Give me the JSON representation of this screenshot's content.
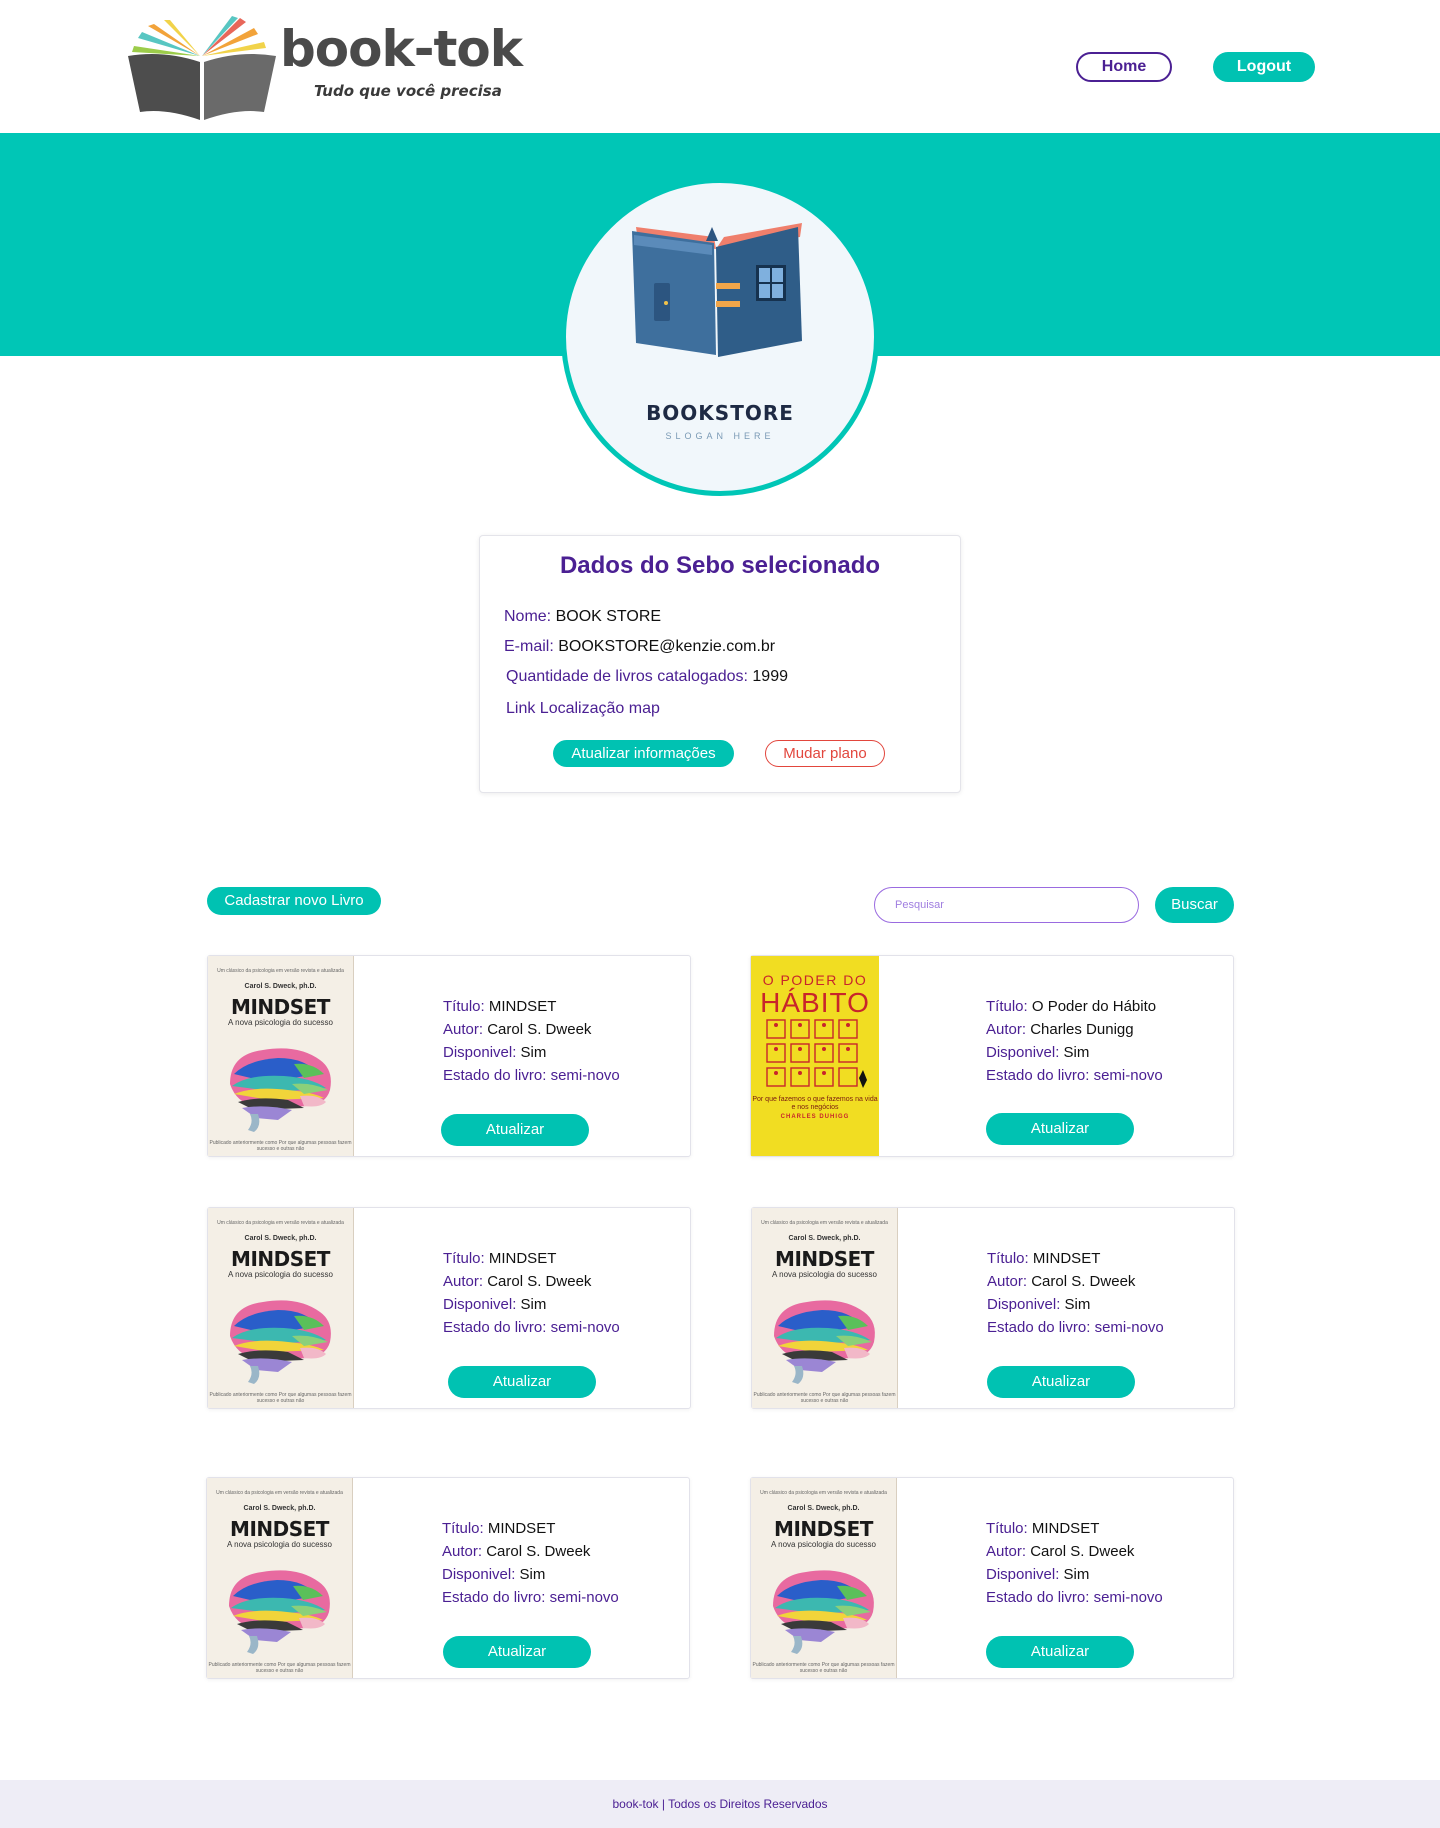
{
  "header": {
    "logo_title": "book-tok",
    "logo_subtitle": "Tudo que você precisa",
    "nav_home": "Home",
    "nav_logout": "Logout"
  },
  "profile": {
    "store_logo_name": "BOOKSTORE",
    "store_logo_slogan": "SLOGAN HERE"
  },
  "store_info": {
    "title": "Dados do Sebo selecionado",
    "name_label": "Nome:",
    "name_value": "BOOK STORE",
    "email_label": "E-mail:",
    "email_value": "BOOKSTORE@kenzie.com.br",
    "count_label": "Quantidade de livros catalogados:",
    "count_value": "1999",
    "map_link": "Link Localização map",
    "update_button": "Atualizar informações",
    "plan_button": "Mudar plano"
  },
  "toolbar": {
    "new_book_button": "Cadastrar novo Livro",
    "search_placeholder": "Pesquisar",
    "search_button": "Buscar"
  },
  "labels": {
    "title": "Título:",
    "author": "Autor:",
    "available": "Disponivel:",
    "condition": "Estado do livro:",
    "update_button": "Atualizar"
  },
  "covers": {
    "mindset": {
      "top_text": "Um clássico da psicologia em versão revista e atualizada",
      "author": "Carol S. Dweck, ph.D.",
      "title": "MINDSET",
      "subtitle": "A nova psicologia do sucesso",
      "bottom_text": "Publicado anteriormente como Por que algumas pessoas fazem sucesso e outras não"
    },
    "habito": {
      "pre": "O PODER DO",
      "main": "HÁBITO",
      "tagline": "Por que fazemos o que fazemos na vida e nos negócios",
      "author": "CHARLES DUHIGG"
    }
  },
  "books": [
    {
      "title": "MINDSET",
      "author": "Carol S. Dweek",
      "available": "Sim",
      "condition": "semi-novo",
      "cover": "mindset"
    },
    {
      "title": "O Poder do Hábito",
      "author": "Charles Dunigg",
      "available": "Sim",
      "condition": "semi-novo",
      "cover": "habito"
    },
    {
      "title": "MINDSET",
      "author": "Carol S. Dweek",
      "available": "Sim",
      "condition": "semi-novo",
      "cover": "mindset"
    },
    {
      "title": "MINDSET",
      "author": "Carol S. Dweek",
      "available": "Sim",
      "condition": "semi-novo",
      "cover": "mindset"
    },
    {
      "title": "MINDSET",
      "author": "Carol S. Dweek",
      "available": "Sim",
      "condition": "semi-novo",
      "cover": "mindset"
    },
    {
      "title": "MINDSET",
      "author": "Carol S. Dweek",
      "available": "Sim",
      "condition": "semi-novo",
      "cover": "mindset"
    }
  ],
  "footer": {
    "text": "book-tok | Todos os Direitos Reservados"
  },
  "colors": {
    "accent_teal": "#00c2b2",
    "brand_purple": "#4b2093",
    "danger_red": "#e2463d",
    "footer_bg": "#eeedf6"
  },
  "icons": [
    "open-book-logo-icon",
    "bookstore-book-icon",
    "brain-illustration-icon"
  ]
}
